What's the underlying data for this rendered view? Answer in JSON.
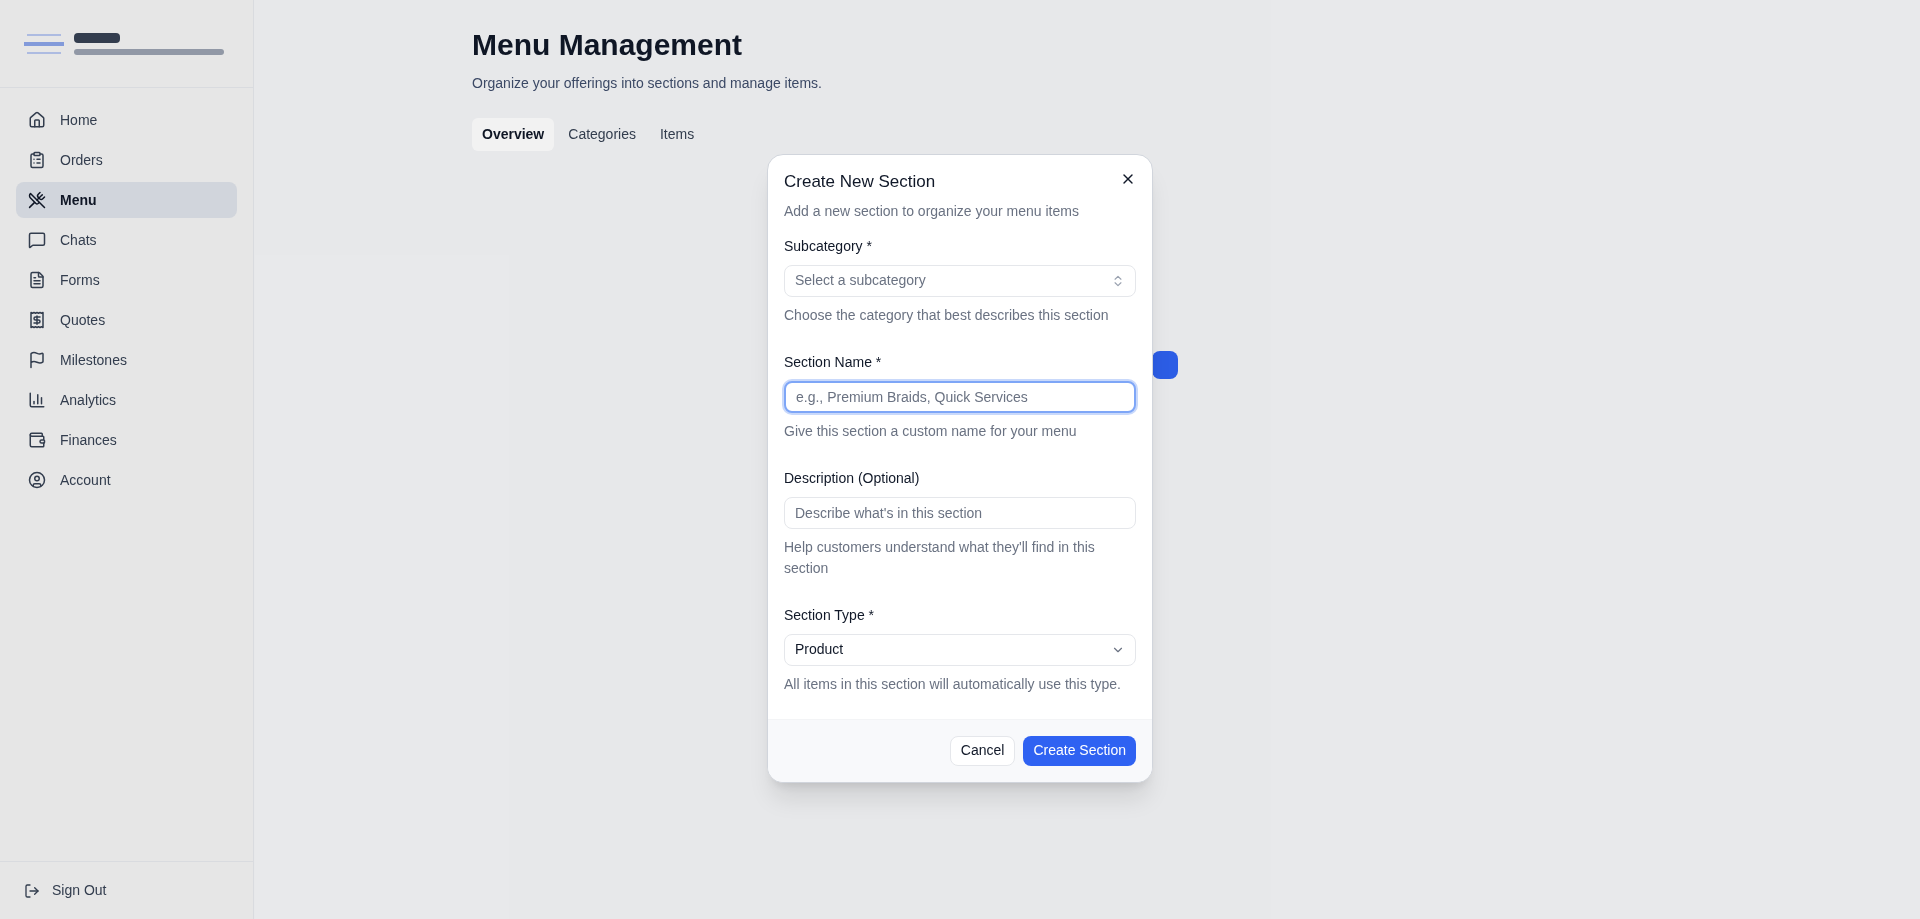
{
  "sidebar": {
    "items": [
      {
        "label": "Home",
        "selected": false
      },
      {
        "label": "Orders",
        "selected": false
      },
      {
        "label": "Menu",
        "selected": true
      },
      {
        "label": "Chats",
        "selected": false
      },
      {
        "label": "Forms",
        "selected": false
      },
      {
        "label": "Quotes",
        "selected": false
      },
      {
        "label": "Milestones",
        "selected": false
      },
      {
        "label": "Analytics",
        "selected": false
      },
      {
        "label": "Finances",
        "selected": false
      },
      {
        "label": "Account",
        "selected": false
      }
    ],
    "sign_out": "Sign Out"
  },
  "page": {
    "title": "Menu Management",
    "subtitle": "Organize your offerings into sections and manage items.",
    "tabs": [
      {
        "label": "Overview",
        "selected": true
      },
      {
        "label": "Categories",
        "selected": false
      },
      {
        "label": "Items",
        "selected": false
      }
    ]
  },
  "dialog": {
    "title": "Create New Section",
    "description": "Add a new section to organize your menu items",
    "fields": [
      {
        "kind": "select",
        "label": "Subcategory *",
        "placeholder": "Select a subcategory",
        "help": "Choose the category that best describes this section",
        "focused": false
      },
      {
        "kind": "input",
        "label": "Section Name *",
        "placeholder": "e.g., Premium Braids, Quick Services",
        "help": "Give this section a custom name for your menu",
        "focused": true
      },
      {
        "kind": "input",
        "label": "Description (Optional)",
        "placeholder": "Describe what's in this section",
        "help": "Help customers understand what they'll find in this section",
        "focused": false
      },
      {
        "kind": "dropdown",
        "label": "Section Type *",
        "value": "Product",
        "help": "All items in this section will automatically use this type.",
        "focused": false
      }
    ],
    "buttons": [
      {
        "kind": "secondary",
        "label": "Cancel"
      },
      {
        "kind": "primary",
        "label": "Create Section"
      }
    ]
  }
}
